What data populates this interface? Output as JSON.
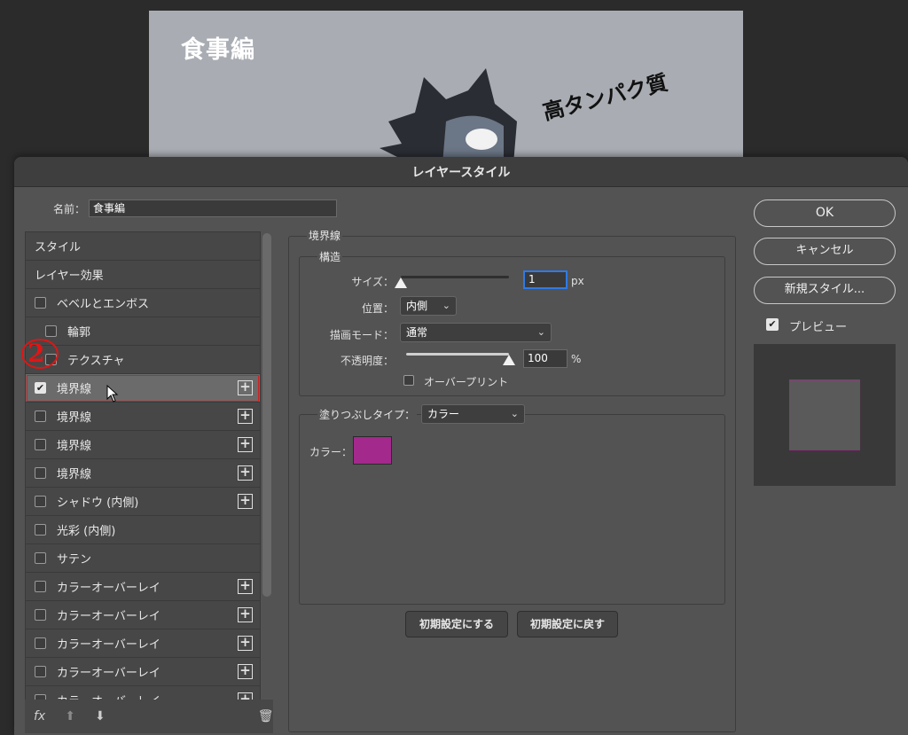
{
  "document": {
    "title": "食事編",
    "headline": "高タンパク質"
  },
  "dialog": {
    "title": "レイヤースタイル",
    "name_label": "名前：",
    "name_value": "食事編"
  },
  "style_list": {
    "items": [
      {
        "label": "スタイル",
        "type": "head"
      },
      {
        "label": "レイヤー効果",
        "type": "head"
      },
      {
        "label": "ベベルとエンボス",
        "checked": false,
        "plus": false
      },
      {
        "label": "輪郭",
        "checked": false,
        "plus": false,
        "indent": true
      },
      {
        "label": "テクスチャ",
        "checked": false,
        "plus": false,
        "indent": true
      },
      {
        "label": "境界線",
        "checked": true,
        "plus": true,
        "selected": true
      },
      {
        "label": "境界線",
        "checked": false,
        "plus": true
      },
      {
        "label": "境界線",
        "checked": false,
        "plus": true
      },
      {
        "label": "境界線",
        "checked": false,
        "plus": true
      },
      {
        "label": "シャドウ (内側)",
        "checked": false,
        "plus": true
      },
      {
        "label": "光彩 (内側)",
        "checked": false,
        "plus": false
      },
      {
        "label": "サテン",
        "checked": false,
        "plus": false
      },
      {
        "label": "カラーオーバーレイ",
        "checked": false,
        "plus": true
      },
      {
        "label": "カラーオーバーレイ",
        "checked": false,
        "plus": true
      },
      {
        "label": "カラーオーバーレイ",
        "checked": false,
        "plus": true
      },
      {
        "label": "カラーオーバーレイ",
        "checked": false,
        "plus": true
      },
      {
        "label": "カラーオーバーレイ",
        "checked": false,
        "plus": true
      }
    ],
    "footer": {
      "fx": "fx",
      "up_icon": "arrow-up-icon",
      "down_icon": "arrow-down-icon",
      "trash_icon": "trash-icon"
    }
  },
  "annotation": {
    "number": "2"
  },
  "stroke": {
    "section_title": "境界線",
    "structure_title": "構造",
    "size_label": "サイズ：",
    "size_value": "1",
    "size_unit": "px",
    "size_level": 0,
    "position_label": "位置：",
    "position_value": "内側",
    "blend_label": "描画モード：",
    "blend_value": "通常",
    "opacity_label": "不透明度：",
    "opacity_value": "100",
    "opacity_unit": "%",
    "opacity_level": 1.0,
    "overprint_label": "オーバープリント",
    "fill_type_label": "塗りつぶしタイプ：",
    "fill_type_value": "カラー",
    "color_label": "カラー：",
    "color_hex": "#a3298c",
    "default_set_label": "初期設定にする",
    "default_reset_label": "初期設定に戻す"
  },
  "actions": {
    "ok_label": "OK",
    "cancel_label": "キャンセル",
    "new_style_label": "新規スタイル...",
    "preview_label": "プレビュー",
    "preview_checked": true
  }
}
